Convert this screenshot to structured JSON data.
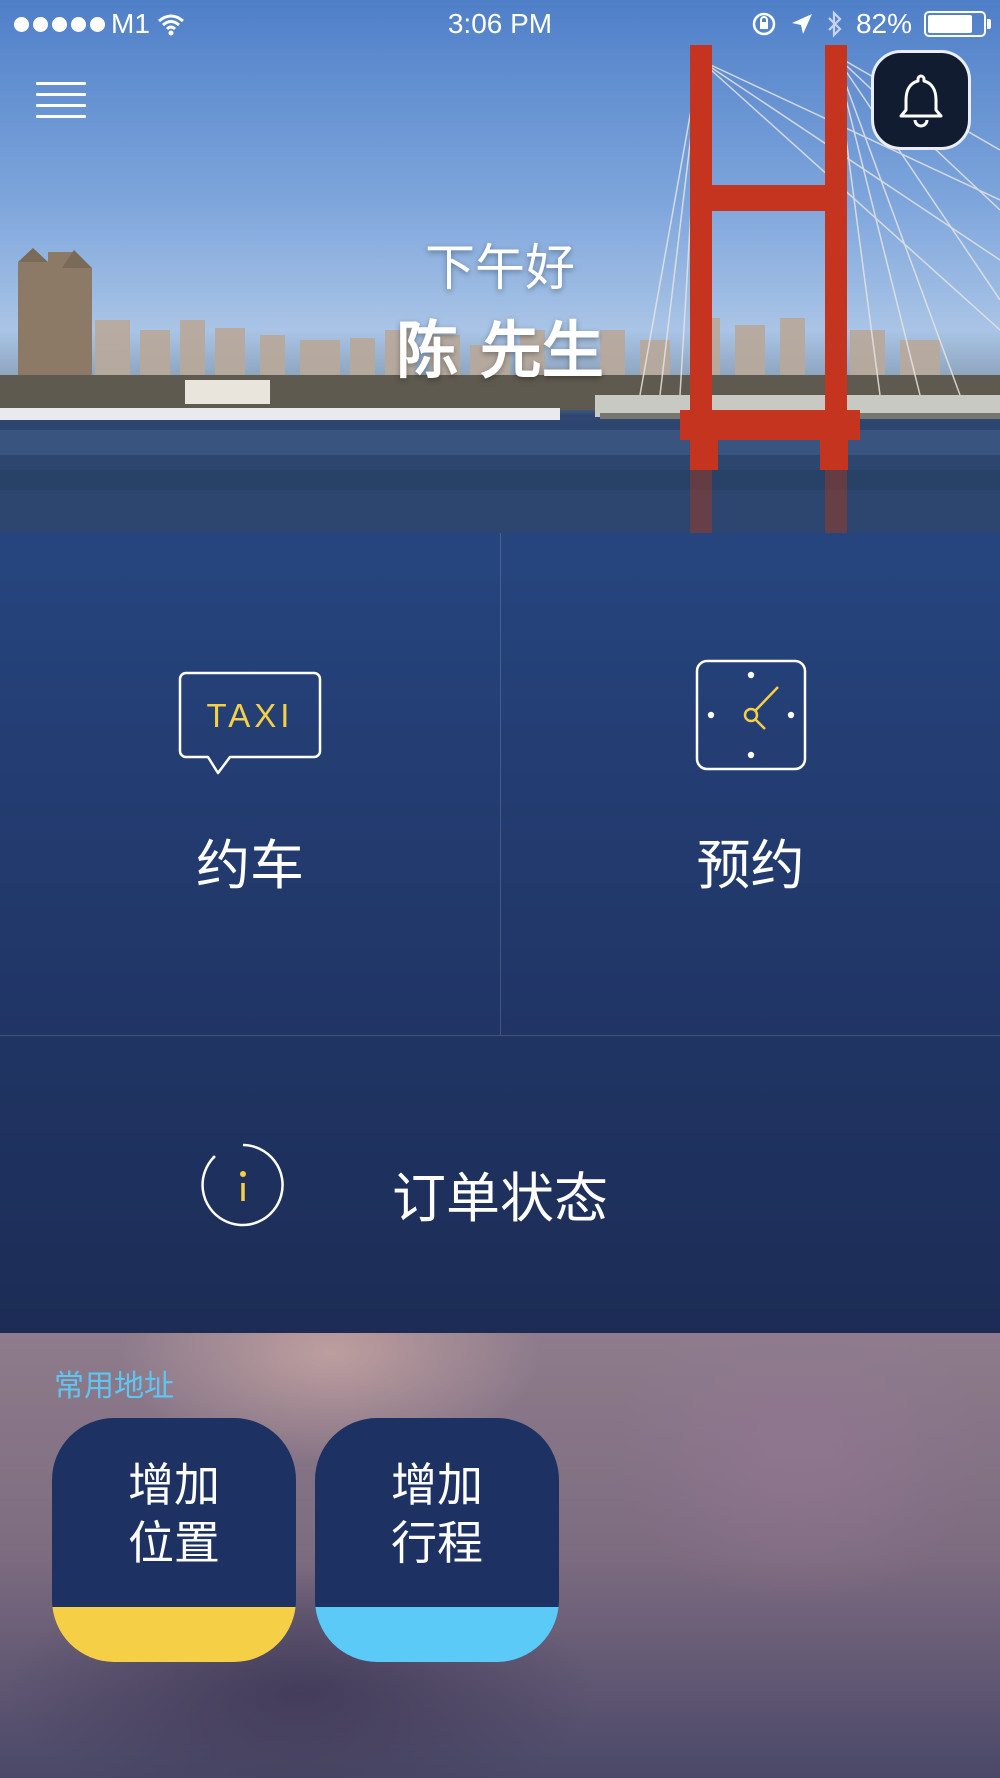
{
  "status_bar": {
    "carrier": "M1",
    "time": "3:06 PM",
    "battery": "82%",
    "battery_level": 0.82,
    "icons": [
      "signal-dots-icon",
      "wifi-icon",
      "rotation-lock-icon",
      "location-arrow-icon",
      "bluetooth-icon",
      "battery-icon"
    ]
  },
  "header": {
    "menu_icon": "hamburger-icon",
    "notification_icon": "bell-icon",
    "greeting": "下午好",
    "user_name": "陈 先生"
  },
  "actions": {
    "book": {
      "label": "约车",
      "icon": "taxi-icon",
      "icon_text": "TAXI"
    },
    "reserve": {
      "label": "预约",
      "icon": "clock-icon"
    },
    "order_status": {
      "label": "订单状态",
      "icon": "info-icon",
      "icon_text": "i"
    }
  },
  "favorites": {
    "title": "常用地址",
    "cards": [
      {
        "line1": "增加",
        "line2": "位置",
        "accent": "#f5cf45"
      },
      {
        "line1": "增加",
        "line2": "行程",
        "accent": "#5ccaf7"
      }
    ]
  },
  "colors": {
    "panel": "#22396c",
    "accent_yellow": "#f5cf45",
    "accent_blue": "#5ccaf7",
    "label_blue": "#5fc6f3"
  }
}
